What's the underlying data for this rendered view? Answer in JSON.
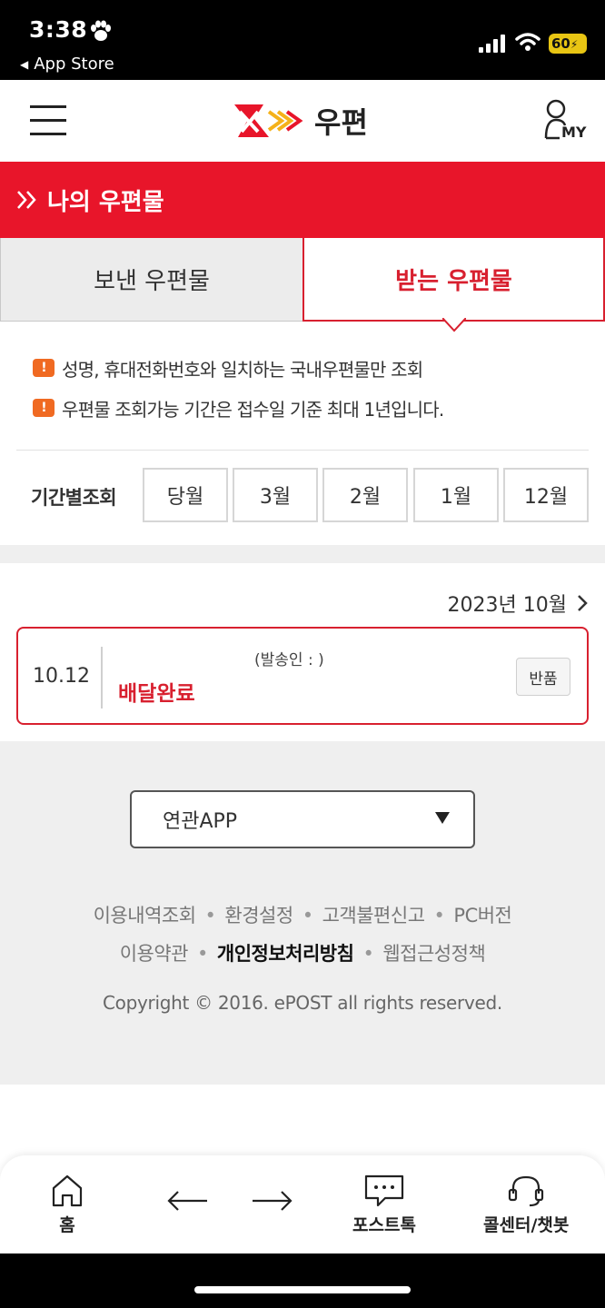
{
  "status_bar": {
    "time": "3:38",
    "back_label": "App Store",
    "battery": "60"
  },
  "header": {
    "logo_text": "우편",
    "my_label": "MY"
  },
  "section": {
    "title": "나의 우편물"
  },
  "tabs": [
    {
      "label": "보낸 우편물",
      "active": false
    },
    {
      "label": "받는 우편물",
      "active": true
    }
  ],
  "notices": [
    "성명, 휴대전화번호와 일치하는 국내우편물만 조회",
    "우편물 조회가능 기간은 접수일 기준 최대 1년입니다."
  ],
  "period_filter": {
    "label": "기간별조회",
    "buttons": [
      "당월",
      "3월",
      "2월",
      "1월",
      "12월"
    ]
  },
  "month_nav": {
    "label": "2023년 10월"
  },
  "mail_items": [
    {
      "date": "10.12",
      "sender": "(발송인 :              )",
      "status": "배달완료",
      "action": "반품"
    }
  ],
  "footer": {
    "app_select": "연관APP",
    "links_row1": [
      "이용내역조회",
      "환경설정",
      "고객불편신고",
      "PC버전"
    ],
    "links_row2": [
      "이용약관",
      "개인정보처리방침",
      "웹접근성정책"
    ],
    "copyright": "Copyright © 2016. ePOST all rights reserved."
  },
  "bottom_nav": {
    "home": "홈",
    "posttalk": "포스트톡",
    "callcenter": "콜센터/챗봇"
  },
  "colors": {
    "brand_red": "#e8152a",
    "active_tab": "#d8202f",
    "warning_orange": "#f06a22",
    "battery_yellow": "#e8c513"
  }
}
